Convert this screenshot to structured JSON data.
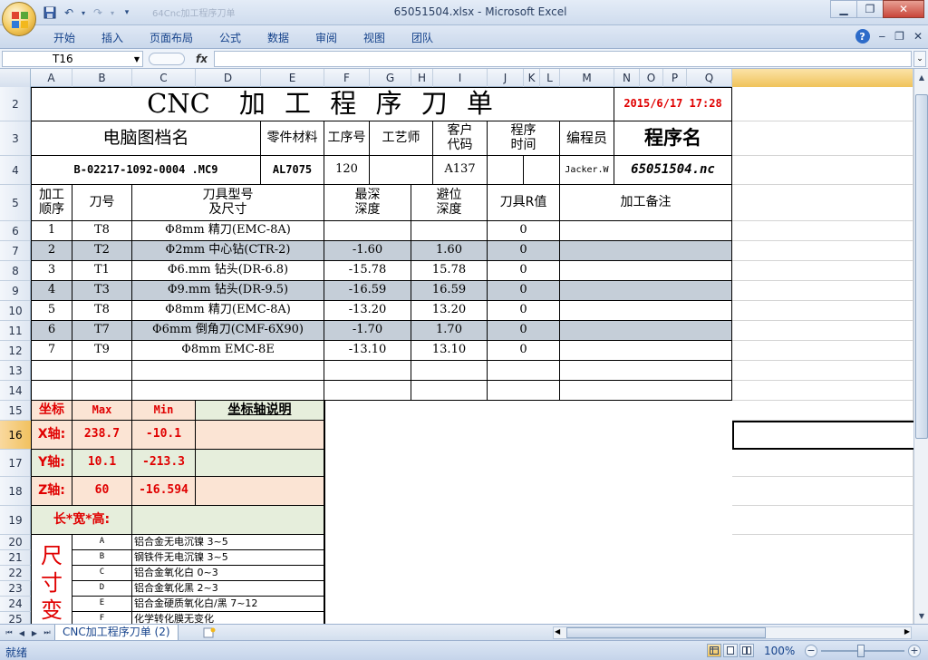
{
  "window": {
    "title": "65051504.xlsx - Microsoft Excel",
    "title_faint": "64Cnc加工程序刀单"
  },
  "qat": {
    "save_icon": "save-icon",
    "undo_icon": "undo-icon",
    "redo_icon": "redo-icon",
    "customize_icon": "chevron-down-icon"
  },
  "ribbon": {
    "tabs": [
      "开始",
      "插入",
      "页面布局",
      "公式",
      "数据",
      "审阅",
      "视图",
      "团队"
    ]
  },
  "formula_bar": {
    "name_box": "T16",
    "fx": "fx",
    "formula": ""
  },
  "columns": [
    "A",
    "B",
    "C",
    "D",
    "E",
    "F",
    "G",
    "H",
    "I",
    "J",
    "K",
    "L",
    "M",
    "N",
    "O",
    "P",
    "Q"
  ],
  "rows": [
    "2",
    "3",
    "4",
    "5",
    "6",
    "7",
    "8",
    "9",
    "10",
    "11",
    "12",
    "13",
    "14",
    "15",
    "16",
    "17",
    "18",
    "19",
    "20",
    "21",
    "22",
    "23",
    "24",
    "25"
  ],
  "sheet": {
    "title_cnc": "CNC",
    "title_main": "加 工 程 序 刀 单",
    "datetime": "2015/6/17  17:28",
    "header3": {
      "drawing_name": "电脑图档名",
      "material": "零件材料",
      "process_no": "工序号",
      "technologist": "工艺师",
      "customer_code_1": "客户",
      "customer_code_2": "代码",
      "program_time_1": "程序",
      "program_time_2": "时间",
      "programmer": "编程员",
      "program_name": "程序名"
    },
    "row4": {
      "drawing_file": "B-02217-1092-0004 .MC9",
      "material": "AL7075",
      "process_no": "120",
      "customer_code": "A137",
      "programmer": "Jacker.W",
      "program_name": "65051504.nc"
    },
    "table_head": {
      "seq_1": "加工",
      "seq_2": "顺序",
      "tool_no": "刀号",
      "tool_type_1": "刀具型号",
      "tool_type_2": "及尺寸",
      "max_depth_1": "最深",
      "max_depth_2": "深度",
      "clear_1": "避位",
      "clear_2": "深度",
      "r_value": "刀具R值",
      "remark": "加工备注"
    },
    "tools": [
      {
        "seq": "1",
        "tool": "T8",
        "spec": "Φ8mm 精刀(EMC-8A)",
        "depth": "",
        "clear": "",
        "r": "0"
      },
      {
        "seq": "2",
        "tool": "T2",
        "spec": "Φ2mm 中心钻(CTR-2)",
        "depth": "-1.60",
        "clear": "1.60",
        "r": "0"
      },
      {
        "seq": "3",
        "tool": "T1",
        "spec": "Φ6.mm 钻头(DR-6.8)",
        "depth": "-15.78",
        "clear": "15.78",
        "r": "0"
      },
      {
        "seq": "4",
        "tool": "T3",
        "spec": "Φ9.mm 钻头(DR-9.5)",
        "depth": "-16.59",
        "clear": "16.59",
        "r": "0"
      },
      {
        "seq": "5",
        "tool": "T8",
        "spec": "Φ8mm 精刀(EMC-8A)",
        "depth": "-13.20",
        "clear": "13.20",
        "r": "0"
      },
      {
        "seq": "6",
        "tool": "T7",
        "spec": "Φ6mm 倒角刀(CMF-6X90)",
        "depth": "-1.70",
        "clear": "1.70",
        "r": "0"
      },
      {
        "seq": "7",
        "tool": "T9",
        "spec": "Φ8mm EMC-8E",
        "depth": "-13.10",
        "clear": "13.10",
        "r": "0"
      }
    ],
    "axis": {
      "label": "坐标",
      "max": "Max",
      "min": "Min",
      "desc": "坐标轴说明",
      "rows": [
        {
          "axis": "X轴:",
          "max": "238.7",
          "min": "-10.1"
        },
        {
          "axis": "Y轴:",
          "max": "10.1",
          "min": "-213.3"
        },
        {
          "axis": "Z轴:",
          "max": "60",
          "min": "-16.594"
        }
      ]
    },
    "lwh": "长*宽*高:",
    "size_change": [
      "尺",
      "寸",
      "变"
    ],
    "finishes": [
      {
        "code": "A",
        "desc": "铝合金无电沉镍  3~5"
      },
      {
        "code": "B",
        "desc": "钢铁件无电沉镍  3~5"
      },
      {
        "code": "C",
        "desc": "铝合金氧化白  0~3"
      },
      {
        "code": "D",
        "desc": "铝合金氧化黑  2~3"
      },
      {
        "code": "E",
        "desc": "铝合金硬质氧化白/黑   7~12"
      },
      {
        "code": "F",
        "desc": "化学转化膜无变化"
      }
    ]
  },
  "tabs": {
    "sheet": "CNC加工程序刀单 (2)"
  },
  "status": {
    "text": "就绪",
    "zoom": "100%"
  }
}
